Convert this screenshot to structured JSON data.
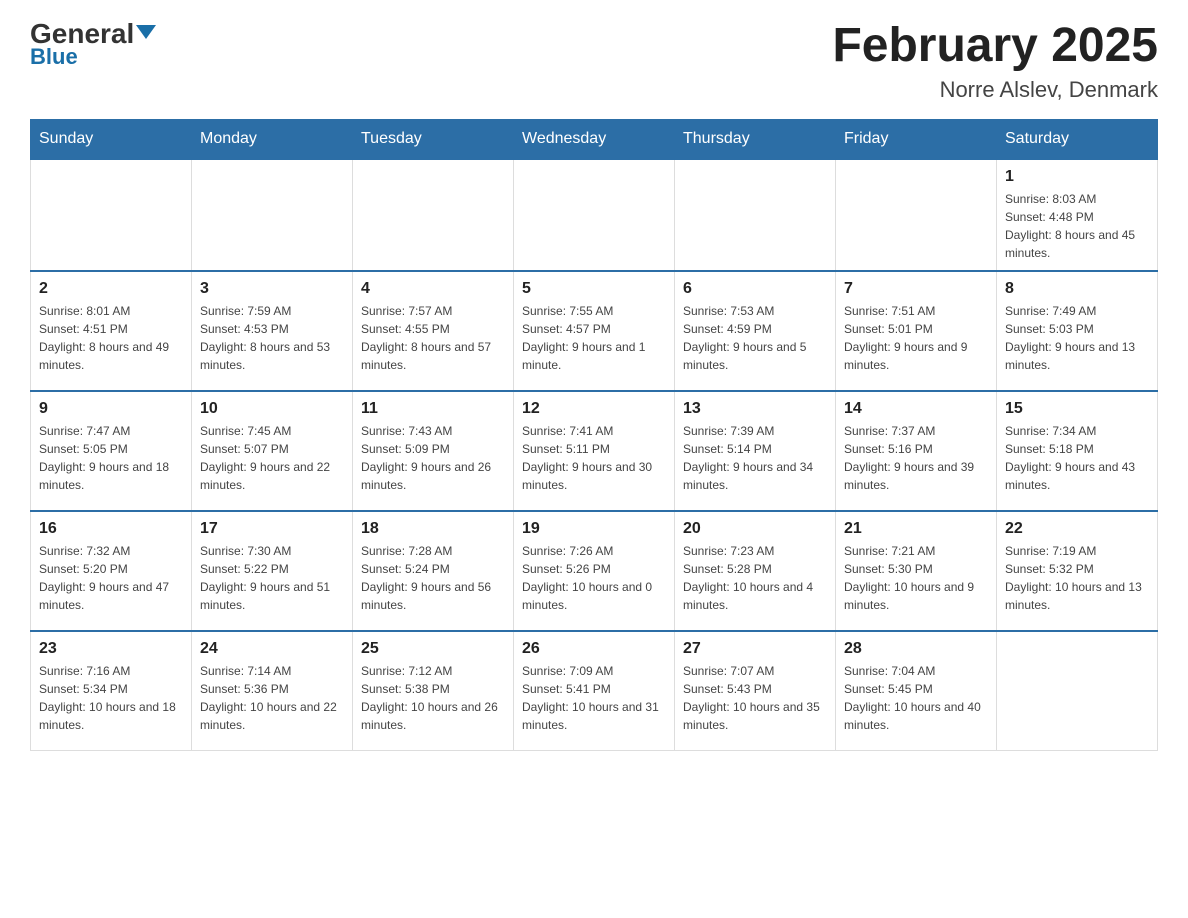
{
  "header": {
    "logo_general": "General",
    "logo_blue": "Blue",
    "month_title": "February 2025",
    "location": "Norre Alslev, Denmark"
  },
  "days_of_week": [
    "Sunday",
    "Monday",
    "Tuesday",
    "Wednesday",
    "Thursday",
    "Friday",
    "Saturday"
  ],
  "weeks": [
    [
      null,
      null,
      null,
      null,
      null,
      null,
      {
        "day": "1",
        "sunrise": "Sunrise: 8:03 AM",
        "sunset": "Sunset: 4:48 PM",
        "daylight": "Daylight: 8 hours and 45 minutes."
      }
    ],
    [
      {
        "day": "2",
        "sunrise": "Sunrise: 8:01 AM",
        "sunset": "Sunset: 4:51 PM",
        "daylight": "Daylight: 8 hours and 49 minutes."
      },
      {
        "day": "3",
        "sunrise": "Sunrise: 7:59 AM",
        "sunset": "Sunset: 4:53 PM",
        "daylight": "Daylight: 8 hours and 53 minutes."
      },
      {
        "day": "4",
        "sunrise": "Sunrise: 7:57 AM",
        "sunset": "Sunset: 4:55 PM",
        "daylight": "Daylight: 8 hours and 57 minutes."
      },
      {
        "day": "5",
        "sunrise": "Sunrise: 7:55 AM",
        "sunset": "Sunset: 4:57 PM",
        "daylight": "Daylight: 9 hours and 1 minute."
      },
      {
        "day": "6",
        "sunrise": "Sunrise: 7:53 AM",
        "sunset": "Sunset: 4:59 PM",
        "daylight": "Daylight: 9 hours and 5 minutes."
      },
      {
        "day": "7",
        "sunrise": "Sunrise: 7:51 AM",
        "sunset": "Sunset: 5:01 PM",
        "daylight": "Daylight: 9 hours and 9 minutes."
      },
      {
        "day": "8",
        "sunrise": "Sunrise: 7:49 AM",
        "sunset": "Sunset: 5:03 PM",
        "daylight": "Daylight: 9 hours and 13 minutes."
      }
    ],
    [
      {
        "day": "9",
        "sunrise": "Sunrise: 7:47 AM",
        "sunset": "Sunset: 5:05 PM",
        "daylight": "Daylight: 9 hours and 18 minutes."
      },
      {
        "day": "10",
        "sunrise": "Sunrise: 7:45 AM",
        "sunset": "Sunset: 5:07 PM",
        "daylight": "Daylight: 9 hours and 22 minutes."
      },
      {
        "day": "11",
        "sunrise": "Sunrise: 7:43 AM",
        "sunset": "Sunset: 5:09 PM",
        "daylight": "Daylight: 9 hours and 26 minutes."
      },
      {
        "day": "12",
        "sunrise": "Sunrise: 7:41 AM",
        "sunset": "Sunset: 5:11 PM",
        "daylight": "Daylight: 9 hours and 30 minutes."
      },
      {
        "day": "13",
        "sunrise": "Sunrise: 7:39 AM",
        "sunset": "Sunset: 5:14 PM",
        "daylight": "Daylight: 9 hours and 34 minutes."
      },
      {
        "day": "14",
        "sunrise": "Sunrise: 7:37 AM",
        "sunset": "Sunset: 5:16 PM",
        "daylight": "Daylight: 9 hours and 39 minutes."
      },
      {
        "day": "15",
        "sunrise": "Sunrise: 7:34 AM",
        "sunset": "Sunset: 5:18 PM",
        "daylight": "Daylight: 9 hours and 43 minutes."
      }
    ],
    [
      {
        "day": "16",
        "sunrise": "Sunrise: 7:32 AM",
        "sunset": "Sunset: 5:20 PM",
        "daylight": "Daylight: 9 hours and 47 minutes."
      },
      {
        "day": "17",
        "sunrise": "Sunrise: 7:30 AM",
        "sunset": "Sunset: 5:22 PM",
        "daylight": "Daylight: 9 hours and 51 minutes."
      },
      {
        "day": "18",
        "sunrise": "Sunrise: 7:28 AM",
        "sunset": "Sunset: 5:24 PM",
        "daylight": "Daylight: 9 hours and 56 minutes."
      },
      {
        "day": "19",
        "sunrise": "Sunrise: 7:26 AM",
        "sunset": "Sunset: 5:26 PM",
        "daylight": "Daylight: 10 hours and 0 minutes."
      },
      {
        "day": "20",
        "sunrise": "Sunrise: 7:23 AM",
        "sunset": "Sunset: 5:28 PM",
        "daylight": "Daylight: 10 hours and 4 minutes."
      },
      {
        "day": "21",
        "sunrise": "Sunrise: 7:21 AM",
        "sunset": "Sunset: 5:30 PM",
        "daylight": "Daylight: 10 hours and 9 minutes."
      },
      {
        "day": "22",
        "sunrise": "Sunrise: 7:19 AM",
        "sunset": "Sunset: 5:32 PM",
        "daylight": "Daylight: 10 hours and 13 minutes."
      }
    ],
    [
      {
        "day": "23",
        "sunrise": "Sunrise: 7:16 AM",
        "sunset": "Sunset: 5:34 PM",
        "daylight": "Daylight: 10 hours and 18 minutes."
      },
      {
        "day": "24",
        "sunrise": "Sunrise: 7:14 AM",
        "sunset": "Sunset: 5:36 PM",
        "daylight": "Daylight: 10 hours and 22 minutes."
      },
      {
        "day": "25",
        "sunrise": "Sunrise: 7:12 AM",
        "sunset": "Sunset: 5:38 PM",
        "daylight": "Daylight: 10 hours and 26 minutes."
      },
      {
        "day": "26",
        "sunrise": "Sunrise: 7:09 AM",
        "sunset": "Sunset: 5:41 PM",
        "daylight": "Daylight: 10 hours and 31 minutes."
      },
      {
        "day": "27",
        "sunrise": "Sunrise: 7:07 AM",
        "sunset": "Sunset: 5:43 PM",
        "daylight": "Daylight: 10 hours and 35 minutes."
      },
      {
        "day": "28",
        "sunrise": "Sunrise: 7:04 AM",
        "sunset": "Sunset: 5:45 PM",
        "daylight": "Daylight: 10 hours and 40 minutes."
      },
      null
    ]
  ]
}
